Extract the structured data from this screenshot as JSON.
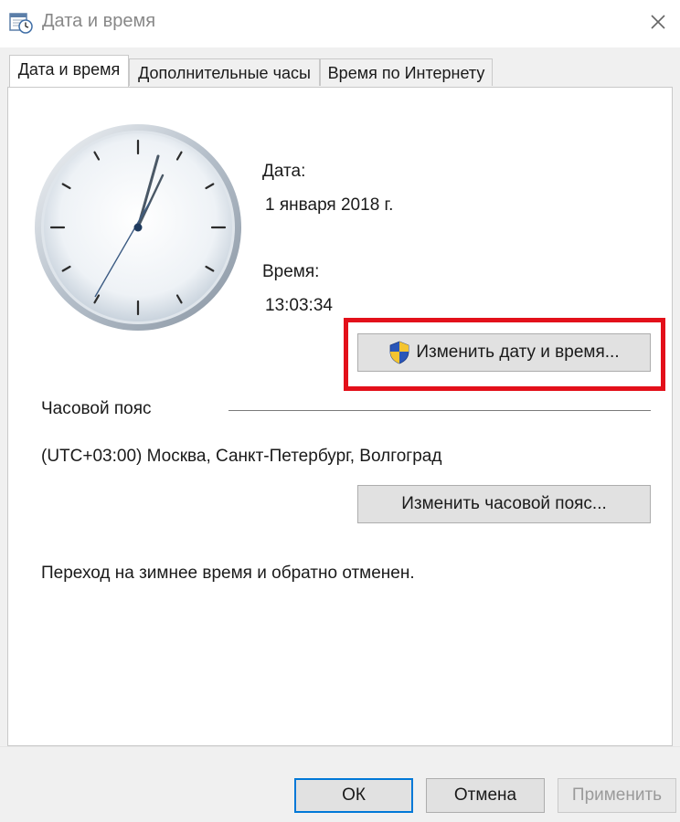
{
  "window": {
    "title": "Дата и время"
  },
  "tabs": [
    {
      "label": "Дата и время"
    },
    {
      "label": "Дополнительные часы"
    },
    {
      "label": "Время по Интернету"
    }
  ],
  "date_section": {
    "label": "Дата:",
    "value": "1 января 2018 г."
  },
  "time_section": {
    "label": "Время:",
    "value": "13:03:34"
  },
  "change_datetime_button": "Изменить дату и время...",
  "timezone": {
    "heading": "Часовой пояс",
    "value": "(UTC+03:00) Москва, Санкт-Петербург, Волгоград",
    "change_button": "Изменить часовой пояс..."
  },
  "dst_notice": "Переход на зимнее время и обратно отменен.",
  "footer": {
    "ok": "ОК",
    "cancel": "Отмена",
    "apply": "Применить"
  },
  "colors": {
    "highlight": "#e3101a",
    "accent": "#0078d7"
  },
  "icons": {
    "app": "calendar-clock-icon",
    "close": "close-icon",
    "shield": "uac-shield-icon"
  }
}
